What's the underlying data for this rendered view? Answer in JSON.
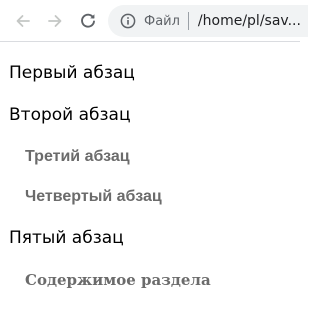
{
  "toolbar": {
    "back_icon": "arrow-left-icon",
    "forward_icon": "arrow-right-icon",
    "reload_icon": "reload-icon",
    "info_icon": "info-icon",
    "site_chip_label": "Файл",
    "url": "/home/pl/sav..."
  },
  "content": {
    "paragraphs": [
      "Первый абзац",
      "Второй абзац",
      "Третий абзац",
      "Четвертый абзац",
      "Пятый абзац"
    ],
    "section_text": "Содержимое раздела"
  },
  "colors": {
    "toolbar_bg": "#ffffff",
    "omnibox_bg": "#f1f3f4",
    "icon_disabled": "#c4c7c5",
    "icon_active": "#5f6368",
    "muted_text": "#6b6b6b",
    "body_text": "#000000"
  }
}
